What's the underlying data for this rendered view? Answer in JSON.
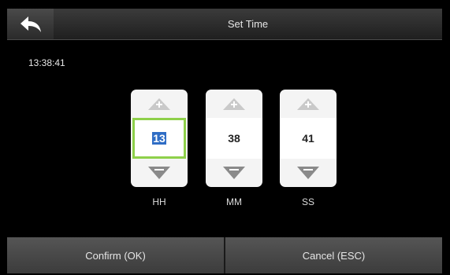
{
  "header": {
    "title": "Set Time",
    "back_icon": "back-arrow-icon"
  },
  "current_time": "13:38:41",
  "spinners": [
    {
      "value": "13",
      "label": "HH",
      "active": true
    },
    {
      "value": "38",
      "label": "MM",
      "active": false
    },
    {
      "value": "41",
      "label": "SS",
      "active": false
    }
  ],
  "footer": {
    "confirm_label": "Confirm (OK)",
    "cancel_label": "Cancel (ESC)"
  },
  "colors": {
    "focus_border": "#8ed04a",
    "selection": "#2f6dc5"
  }
}
